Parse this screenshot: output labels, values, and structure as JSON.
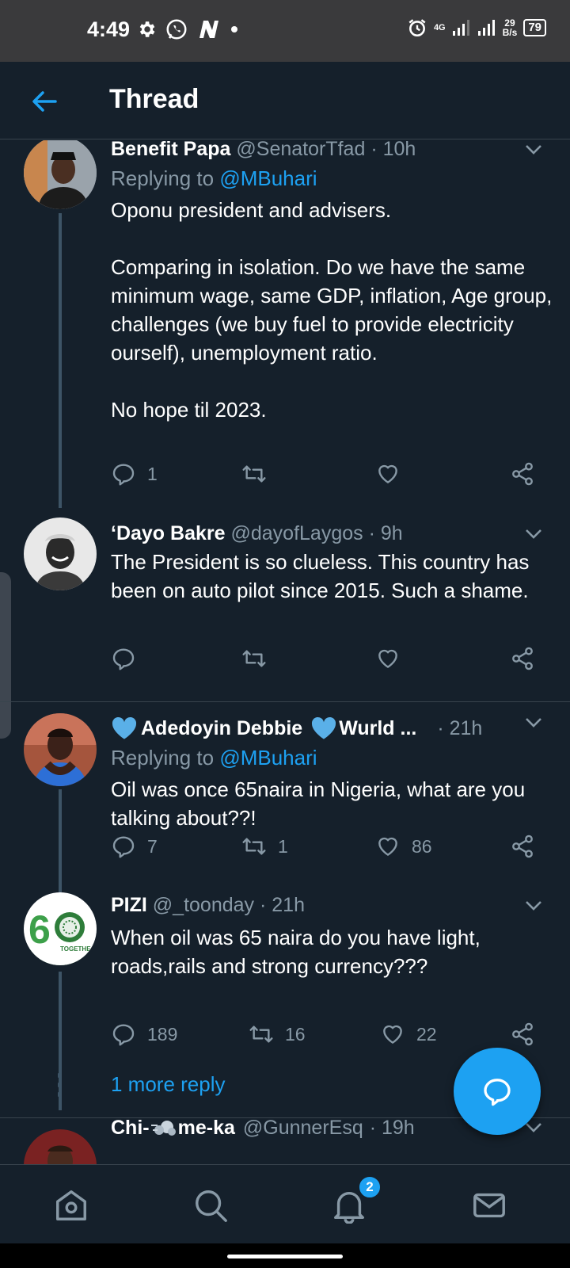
{
  "status_bar": {
    "time": "4:49",
    "net_speed_value": "29",
    "net_speed_unit": "B/s",
    "network_type": "4G",
    "battery": "79",
    "icons": [
      "gear-icon",
      "whatsapp-icon",
      "n-app-icon",
      "dot-icon",
      "alarm-icon",
      "signal-icon",
      "signal-icon"
    ]
  },
  "header": {
    "title": "Thread"
  },
  "tweets": [
    {
      "name": "Benefit Papa",
      "handle": "@SenatorTfad",
      "time": "· 10h",
      "replying_label": "Replying to ",
      "replying_to": "@MBuhari",
      "text": "Oponu president and advisers.\n\nComparing in isolation. Do we have the same minimum wage, same GDP, inflation, Age group, challenges (we buy fuel to provide electricity ourself), unemployment ratio.\n\nNo hope til 2023.",
      "replies": "1",
      "retweets": "",
      "likes": ""
    },
    {
      "name": "‘Dayo Bakre",
      "handle": "@dayofLaygos",
      "time": "· 9h",
      "text": "The President is so clueless. This country has been on auto pilot since 2015. Such a shame.",
      "replies": "",
      "retweets": "",
      "likes": ""
    },
    {
      "name": "Adedoyin Debbie",
      "name_suffix": "Wurld ...",
      "time": "· 21h",
      "replying_label": "Replying to ",
      "replying_to": "@MBuhari",
      "text": "Oil was once 65naira in Nigeria, what are you talking about??!",
      "replies": "7",
      "retweets": "1",
      "likes": "86"
    },
    {
      "name": "PIZI",
      "handle": "@_toonday",
      "time": "· 21h",
      "text": "When oil was 65 naira do you have light, roads,rails and strong currency???",
      "replies": "189",
      "retweets": "16",
      "likes": "22"
    },
    {
      "name": "Chi-",
      "name_suffix": "me-ka",
      "handle": "@GunnerEsq",
      "time": "· 19h"
    }
  ],
  "more_reply": "1 more reply",
  "avatar4_text": "TOGETHE",
  "notifications_badge": "2",
  "colors": {
    "accent": "#1da1f2",
    "background": "#15202b",
    "muted": "#8899a6",
    "divider": "#38444d"
  }
}
